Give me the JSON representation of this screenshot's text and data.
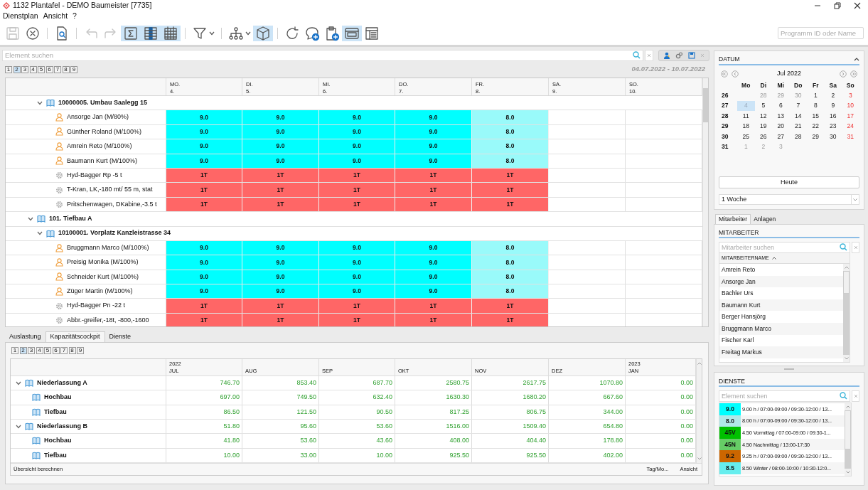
{
  "window": {
    "title": "1132 Plantafel - DEMO Baumeister [7735]"
  },
  "menu": [
    "Dienstplan",
    "Ansicht",
    "?"
  ],
  "toolbar_groups": [
    [
      {
        "kind": "save",
        "disabled": true,
        "active": false,
        "dropdown": false
      },
      {
        "kind": "cancel",
        "disabled": false,
        "active": false,
        "dropdown": false
      }
    ],
    [
      {
        "kind": "preview",
        "disabled": false,
        "active": false,
        "dropdown": false
      }
    ],
    [
      {
        "kind": "undo",
        "disabled": true,
        "active": false,
        "dropdown": false
      },
      {
        "kind": "redo",
        "disabled": true,
        "active": false,
        "dropdown": false
      },
      {
        "kind": "sum",
        "disabled": false,
        "active": true,
        "dropdown": false
      },
      {
        "kind": "columns",
        "disabled": false,
        "active": true,
        "dropdown": false
      },
      {
        "kind": "calendar",
        "disabled": false,
        "active": true,
        "dropdown": false
      }
    ],
    [
      {
        "kind": "filter",
        "disabled": false,
        "active": false,
        "dropdown": true
      }
    ],
    [
      {
        "kind": "hierarchy",
        "disabled": false,
        "active": false,
        "dropdown": true
      },
      {
        "kind": "cube",
        "disabled": false,
        "active": true,
        "dropdown": false
      }
    ],
    [
      {
        "kind": "refresh",
        "disabled": false,
        "active": false,
        "dropdown": false
      },
      {
        "kind": "comment",
        "disabled": false,
        "active": false,
        "dropdown": false
      },
      {
        "kind": "clipboard",
        "disabled": false,
        "active": false,
        "dropdown": false
      },
      {
        "kind": "window",
        "disabled": false,
        "active": true,
        "dropdown": false
      },
      {
        "kind": "layout",
        "disabled": false,
        "active": false,
        "dropdown": false
      }
    ]
  ],
  "program_search": {
    "placeholder": "Programm ID oder Name"
  },
  "plan": {
    "search": {
      "placeholder": "Element suchen"
    },
    "levels": [
      {
        "label": "1",
        "selected": false
      },
      {
        "label": "2",
        "selected": true
      },
      {
        "label": "3",
        "selected": false
      },
      {
        "label": "4",
        "selected": false
      },
      {
        "label": "5",
        "selected": false
      },
      {
        "label": "6",
        "selected": false
      },
      {
        "label": "7",
        "selected": false
      },
      {
        "label": "8",
        "selected": false
      },
      {
        "label": "9",
        "selected": false
      }
    ],
    "date_range": "04.07.2022 - 10.07.2022",
    "columns": [
      {
        "weekday": "MO.",
        "day": "4."
      },
      {
        "weekday": "DI.",
        "day": "5."
      },
      {
        "weekday": "MI.",
        "day": "6."
      },
      {
        "weekday": "DO.",
        "day": "7."
      },
      {
        "weekday": "FR.",
        "day": "8."
      },
      {
        "weekday": "SA.",
        "day": "9."
      },
      {
        "weekday": "SO.",
        "day": "10."
      }
    ],
    "rows": [
      {
        "kind": "project",
        "label": "10000005. Umbau Saalegg 15",
        "expanded": true,
        "children": [
          {
            "kind": "person",
            "label": "Ansorge Jan (M/80%)",
            "cells": [
              {
                "text": "9.0",
                "color": "#00ffff"
              },
              {
                "text": "9.0",
                "color": "#00ffff"
              },
              {
                "text": "9.0",
                "color": "#00ffff"
              },
              {
                "text": "9.0",
                "color": "#00ffff"
              },
              {
                "text": "8.0",
                "color": "#99fafa"
              }
            ]
          },
          {
            "kind": "person",
            "label": "Günther Roland (M/100%)",
            "cells": [
              {
                "text": "9.0",
                "color": "#00ffff"
              },
              {
                "text": "9.0",
                "color": "#00ffff"
              },
              {
                "text": "9.0",
                "color": "#00ffff"
              },
              {
                "text": "9.0",
                "color": "#00ffff"
              },
              {
                "text": "8.0",
                "color": "#99fafa"
              }
            ]
          },
          {
            "kind": "person",
            "label": "Amrein Reto (M/100%)",
            "cells": [
              {
                "text": "9.0",
                "color": "#00ffff"
              },
              {
                "text": "9.0",
                "color": "#00ffff"
              },
              {
                "text": "9.0",
                "color": "#00ffff"
              },
              {
                "text": "9.0",
                "color": "#00ffff"
              },
              {
                "text": "8.0",
                "color": "#99fafa"
              }
            ]
          },
          {
            "kind": "person",
            "label": "Baumann Kurt (M/100%)",
            "cells": [
              {
                "text": "9.0",
                "color": "#00ffff"
              },
              {
                "text": "9.0",
                "color": "#00ffff"
              },
              {
                "text": "9.0",
                "color": "#00ffff"
              },
              {
                "text": "9.0",
                "color": "#00ffff"
              },
              {
                "text": "8.0",
                "color": "#99fafa"
              }
            ]
          },
          {
            "kind": "machine",
            "label": "Hyd-Bagger Rp -5 t",
            "cells": [
              {
                "text": "1T",
                "color": "#ff6666"
              },
              {
                "text": "1T",
                "color": "#ff6666"
              },
              {
                "text": "1T",
                "color": "#ff6666"
              },
              {
                "text": "1T",
                "color": "#ff6666"
              },
              {
                "text": "1T",
                "color": "#ff6666"
              }
            ]
          },
          {
            "kind": "machine",
            "label": "T-Kran, LK,-180 mt/ 55 m, stat",
            "cells": [
              {
                "text": "1T",
                "color": "#ff6666"
              },
              {
                "text": "1T",
                "color": "#ff6666"
              },
              {
                "text": "1T",
                "color": "#ff6666"
              },
              {
                "text": "1T",
                "color": "#ff6666"
              },
              {
                "text": "1T",
                "color": "#ff6666"
              }
            ]
          },
          {
            "kind": "machine",
            "label": "Pritschenwagen, DKabine,-3.5 t",
            "cells": [
              {
                "text": "1T",
                "color": "#ff6666"
              },
              {
                "text": "1T",
                "color": "#ff6666"
              },
              {
                "text": "1T",
                "color": "#ff6666"
              },
              {
                "text": "1T",
                "color": "#ff6666"
              },
              {
                "text": "1T",
                "color": "#ff6666"
              }
            ]
          }
        ]
      },
      {
        "kind": "group",
        "label": "101. Tiefbau A",
        "expanded": true,
        "children": [
          {
            "kind": "project",
            "label": "10100001. Vorplatz Kanzleistrasse 34",
            "expanded": true,
            "children": [
              {
                "kind": "person",
                "label": "Bruggmann Marco (M/100%)",
                "cells": [
                  {
                    "text": "9.0",
                    "color": "#00ffff"
                  },
                  {
                    "text": "9.0",
                    "color": "#00ffff"
                  },
                  {
                    "text": "9.0",
                    "color": "#00ffff"
                  },
                  {
                    "text": "9.0",
                    "color": "#00ffff"
                  },
                  {
                    "text": "8.0",
                    "color": "#99fafa"
                  }
                ]
              },
              {
                "kind": "person",
                "label": "Preisig Monika (M/100%)",
                "cells": [
                  {
                    "text": "9.0",
                    "color": "#00ffff"
                  },
                  {
                    "text": "9.0",
                    "color": "#00ffff"
                  },
                  {
                    "text": "9.0",
                    "color": "#00ffff"
                  },
                  {
                    "text": "9.0",
                    "color": "#00ffff"
                  },
                  {
                    "text": "8.0",
                    "color": "#99fafa"
                  }
                ]
              },
              {
                "kind": "person",
                "label": "Schneider Kurt (M/100%)",
                "cells": [
                  {
                    "text": "9.0",
                    "color": "#00ffff"
                  },
                  {
                    "text": "9.0",
                    "color": "#00ffff"
                  },
                  {
                    "text": "9.0",
                    "color": "#00ffff"
                  },
                  {
                    "text": "9.0",
                    "color": "#00ffff"
                  },
                  {
                    "text": "8.0",
                    "color": "#99fafa"
                  }
                ]
              },
              {
                "kind": "person",
                "label": "Züger Martin (M/100%)",
                "cells": [
                  {
                    "text": "9.0",
                    "color": "#00ffff"
                  },
                  {
                    "text": "9.0",
                    "color": "#00ffff"
                  },
                  {
                    "text": "9.0",
                    "color": "#00ffff"
                  },
                  {
                    "text": "9.0",
                    "color": "#00ffff"
                  },
                  {
                    "text": "8.0",
                    "color": "#99fafa"
                  }
                ]
              },
              {
                "kind": "machine",
                "label": "Hyd-Bagger Pn -22 t",
                "cells": [
                  {
                    "text": "1T",
                    "color": "#ff6666"
                  },
                  {
                    "text": "1T",
                    "color": "#ff6666"
                  },
                  {
                    "text": "1T",
                    "color": "#ff6666"
                  },
                  {
                    "text": "1T",
                    "color": "#ff6666"
                  },
                  {
                    "text": "1T",
                    "color": "#ff6666"
                  }
                ]
              },
              {
                "kind": "machine",
                "label": "Abbr.-greifer,-18t, -800,-1600",
                "cells": [
                  {
                    "text": "1T",
                    "color": "#ff6666"
                  },
                  {
                    "text": "1T",
                    "color": "#ff6666"
                  },
                  {
                    "text": "1T",
                    "color": "#ff6666"
                  },
                  {
                    "text": "1T",
                    "color": "#ff6666"
                  },
                  {
                    "text": "1T",
                    "color": "#ff6666"
                  }
                ]
              }
            ]
          }
        ]
      }
    ]
  },
  "bottom_tabs": [
    {
      "label": "Auslastung",
      "selected": false
    },
    {
      "label": "Kapazitätscockpit",
      "selected": true
    },
    {
      "label": "Dienste",
      "selected": false
    }
  ],
  "capacity": {
    "levels": [
      {
        "label": "1",
        "selected": false
      },
      {
        "label": "2",
        "selected": true
      },
      {
        "label": "3",
        "selected": false
      },
      {
        "label": "4",
        "selected": false
      },
      {
        "label": "5",
        "selected": false
      },
      {
        "label": "6",
        "selected": false
      },
      {
        "label": "7",
        "selected": false
      },
      {
        "label": "8",
        "selected": false
      },
      {
        "label": "9",
        "selected": false
      }
    ],
    "columns": [
      {
        "year": "2022",
        "month": "JUL"
      },
      {
        "month": "AUG"
      },
      {
        "month": "SEP"
      },
      {
        "month": "OKT"
      },
      {
        "month": "NOV"
      },
      {
        "month": "DEZ"
      },
      {
        "year": "2023",
        "month": "JAN"
      }
    ],
    "rows": [
      {
        "label": "Niederlassung A",
        "expanded": true,
        "values": [
          "746.70",
          "853.40",
          "687.70",
          "2580.75",
          "2617.75",
          "1070.80",
          "0.00"
        ],
        "children": [
          {
            "label": "Hochbau",
            "values": [
              "697.00",
              "749.50",
              "632.40",
              "1630.30",
              "1680.20",
              "667.60",
              "0.00"
            ]
          },
          {
            "label": "Tiefbau",
            "values": [
              "86.50",
              "121.50",
              "90.50",
              "817.25",
              "806.75",
              "344.00",
              "0.00"
            ]
          }
        ]
      },
      {
        "label": "Niederlassung B",
        "expanded": true,
        "values": [
          "51.80",
          "95.60",
          "53.60",
          "1516.00",
          "1509.40",
          "654.80",
          "0.00"
        ],
        "children": [
          {
            "label": "Hochbau",
            "values": [
              "41.80",
              "53.60",
              "43.60",
              "408.00",
              "404.40",
              "178.80",
              "0.00"
            ]
          },
          {
            "label": "Tiefbau",
            "values": [
              "10.00",
              "33.00",
              "10.00",
              "925.50",
              "925.50",
              "402.00",
              "0.00"
            ]
          }
        ]
      }
    ],
    "footer": {
      "action": "Übersicht berechnen",
      "unit": "Tag/Mo...",
      "view": "Ansicht"
    }
  },
  "datum": {
    "title": "DATUM",
    "month": "Jul 2022",
    "weekdays": [
      "Mo",
      "Di",
      "Mi",
      "Do",
      "Fr",
      "Sa",
      "So"
    ],
    "weeks": [
      {
        "number": "26",
        "days": [
          {
            "kind": "blank"
          },
          {
            "text": "28",
            "kind": "other",
            "selected": false
          },
          {
            "text": "29",
            "kind": "other",
            "selected": false
          },
          {
            "text": "30",
            "kind": "other",
            "selected": false
          },
          {
            "text": "1",
            "kind": "normal",
            "selected": false
          },
          {
            "text": "2",
            "kind": "normal",
            "selected": false
          },
          {
            "text": "3",
            "kind": "sunday",
            "selected": false
          }
        ]
      },
      {
        "number": "27",
        "days": [
          {
            "text": "4",
            "kind": "normal",
            "selected": true
          },
          {
            "text": "5",
            "kind": "normal",
            "selected": false
          },
          {
            "text": "6",
            "kind": "normal",
            "selected": false
          },
          {
            "text": "7",
            "kind": "normal",
            "selected": false
          },
          {
            "text": "8",
            "kind": "normal",
            "selected": false
          },
          {
            "text": "9",
            "kind": "normal",
            "selected": false
          },
          {
            "text": "10",
            "kind": "sunday",
            "selected": false
          }
        ]
      },
      {
        "number": "28",
        "days": [
          {
            "text": "11",
            "kind": "normal",
            "selected": false
          },
          {
            "text": "12",
            "kind": "normal",
            "selected": false
          },
          {
            "text": "13",
            "kind": "normal",
            "selected": false
          },
          {
            "text": "14",
            "kind": "normal",
            "selected": false
          },
          {
            "text": "15",
            "kind": "normal",
            "selected": false
          },
          {
            "text": "16",
            "kind": "normal",
            "selected": false
          },
          {
            "text": "17",
            "kind": "sunday",
            "selected": false
          }
        ]
      },
      {
        "number": "29",
        "days": [
          {
            "text": "18",
            "kind": "normal",
            "selected": false
          },
          {
            "text": "19",
            "kind": "normal",
            "selected": false
          },
          {
            "text": "20",
            "kind": "normal",
            "selected": false
          },
          {
            "text": "21",
            "kind": "normal",
            "selected": false
          },
          {
            "text": "22",
            "kind": "normal",
            "selected": false
          },
          {
            "text": "23",
            "kind": "normal",
            "selected": false
          },
          {
            "text": "24",
            "kind": "sunday",
            "selected": false
          }
        ]
      },
      {
        "number": "30",
        "days": [
          {
            "text": "25",
            "kind": "normal",
            "selected": false
          },
          {
            "text": "26",
            "kind": "normal",
            "selected": false
          },
          {
            "text": "27",
            "kind": "normal",
            "selected": false
          },
          {
            "text": "28",
            "kind": "normal",
            "selected": false
          },
          {
            "text": "29",
            "kind": "normal",
            "selected": false
          },
          {
            "text": "30",
            "kind": "normal",
            "selected": false
          },
          {
            "text": "31",
            "kind": "sunday",
            "selected": false
          }
        ]
      },
      {
        "number": "31",
        "days": [
          {
            "text": "1",
            "kind": "other",
            "selected": false
          },
          {
            "text": "2",
            "kind": "other",
            "selected": false
          },
          {
            "text": "3",
            "kind": "other",
            "selected": false
          }
        ]
      }
    ],
    "today_button": "Heute",
    "range": "1 Woche"
  },
  "resource_tabs": [
    {
      "label": "Mitarbeiter",
      "selected": true
    },
    {
      "label": "Anlagen",
      "selected": false
    }
  ],
  "employees": {
    "title": "MITARBEITER",
    "search": {
      "placeholder": "Mitarbeiter suchen"
    },
    "column": "MITARBEITERNAME",
    "items": [
      "Amrein Reto",
      "Ansorge Jan",
      "Bächler Urs",
      "Baumann Kurt",
      "Berger Hansjörg",
      "Bruggmann Marco",
      "Fischer Karl",
      "Freitag Markus"
    ]
  },
  "services": {
    "title": "DIENSTE",
    "search": {
      "placeholder": "Element suchen"
    },
    "items": [
      {
        "code": "9.0",
        "color": "#00ffff",
        "text": "9.00 h / 07:00-09:00 / 09:30-12:00 / 13..."
      },
      {
        "code": "8.0",
        "color": "#b0e8e8",
        "text": "8.00 h / 07:00-09:00 / 09:30-12:00 / 13..."
      },
      {
        "code": "45V",
        "color": "#00c000",
        "text": "4.50 Vormittag / 07:00-09:00 / 09:30-1..."
      },
      {
        "code": "45N",
        "color": "#66cc66",
        "text": "4.50 Nachmittag / 13:00-17:30"
      },
      {
        "code": "9.2",
        "color": "#cc6600",
        "text": "9.25 h / 07:00-09:00 / 09:30-12:00 / 13..."
      },
      {
        "code": "8.5",
        "color": "#66eeee",
        "text": "8.50 Winter / 08:00-10:00 / 10:30-12:0..."
      }
    ]
  }
}
